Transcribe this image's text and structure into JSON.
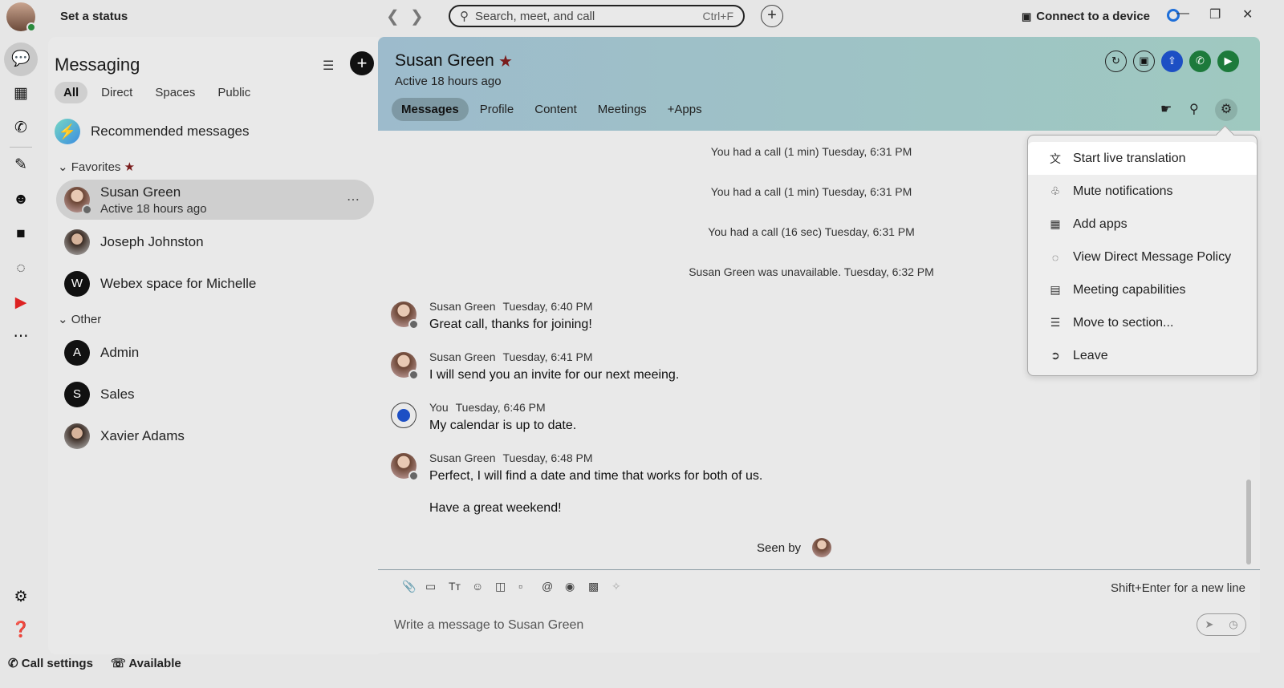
{
  "topbar": {
    "status_label": "Set a status",
    "search_placeholder": "Search, meet, and call",
    "search_shortcut": "Ctrl+F",
    "connect_label": "Connect to a device"
  },
  "messaging": {
    "title": "Messaging",
    "tabs": [
      "All",
      "Direct",
      "Spaces",
      "Public"
    ],
    "active_tab": "All",
    "recommended_label": "Recommended messages",
    "favorites_label": "Favorites",
    "other_label": "Other",
    "favorites": [
      {
        "name": "Susan Green",
        "sub": "Active 18 hours ago",
        "avatar": "photo",
        "selected": true
      },
      {
        "name": "Joseph Johnston",
        "avatar": "photo"
      },
      {
        "name": "Webex space for Michelle",
        "avatar_letter": "W"
      }
    ],
    "other": [
      {
        "name": "Admin",
        "avatar_letter": "A"
      },
      {
        "name": "Sales",
        "avatar_letter": "S"
      },
      {
        "name": "Xavier Adams",
        "avatar": "photo"
      }
    ]
  },
  "bottom": {
    "call_settings": "Call settings",
    "available": "Available"
  },
  "conversation": {
    "name": "Susan Green",
    "active": "Active 18 hours ago",
    "tabs": [
      "Messages",
      "Profile",
      "Content",
      "Meetings",
      "+Apps"
    ],
    "active_tab": "Messages",
    "system_messages": [
      "You had a call (1 min) Tuesday, 6:31 PM",
      "You had a call (1 min) Tuesday, 6:31 PM",
      "You had a call (16 sec) Tuesday, 6:31 PM",
      "Susan Green was unavailable. Tuesday, 6:32 PM"
    ],
    "messages": [
      {
        "sender": "Susan Green",
        "time": "Tuesday, 6:40 PM",
        "text": "Great call, thanks for joining!"
      },
      {
        "sender": "Susan Green",
        "time": "Tuesday, 6:41 PM",
        "text": "I will send you an invite for our next meeing."
      },
      {
        "sender": "You",
        "time": "Tuesday, 6:46 PM",
        "text": "My calendar is up to date."
      },
      {
        "sender": "Susan Green",
        "time": "Tuesday, 6:48 PM",
        "text": "Perfect, I will find a date and time that works for both of us."
      }
    ],
    "followup_text": "Have a great weekend!",
    "seen_by": "Seen by"
  },
  "composer": {
    "hint": "Shift+Enter for a new line",
    "placeholder": "Write a message to Susan Green"
  },
  "settings_menu": {
    "items": [
      {
        "label": "Start live translation",
        "icon": "translate-icon"
      },
      {
        "label": "Mute notifications",
        "icon": "bell-icon"
      },
      {
        "label": "Add apps",
        "icon": "apps-icon"
      },
      {
        "label": "View Direct Message Policy",
        "icon": "policy-icon"
      },
      {
        "label": "Meeting capabilities",
        "icon": "calendar-icon"
      },
      {
        "label": "Move to section...",
        "icon": "section-icon"
      },
      {
        "label": "Leave",
        "icon": "leave-icon"
      }
    ]
  },
  "colors": {
    "header_gradient_start": "#9dbbcc",
    "header_gradient_end": "#9fc9c0",
    "favorite_star": "#7a1d1d",
    "call_green": "#1d7a3b",
    "share_blue": "#1d4fc4"
  }
}
